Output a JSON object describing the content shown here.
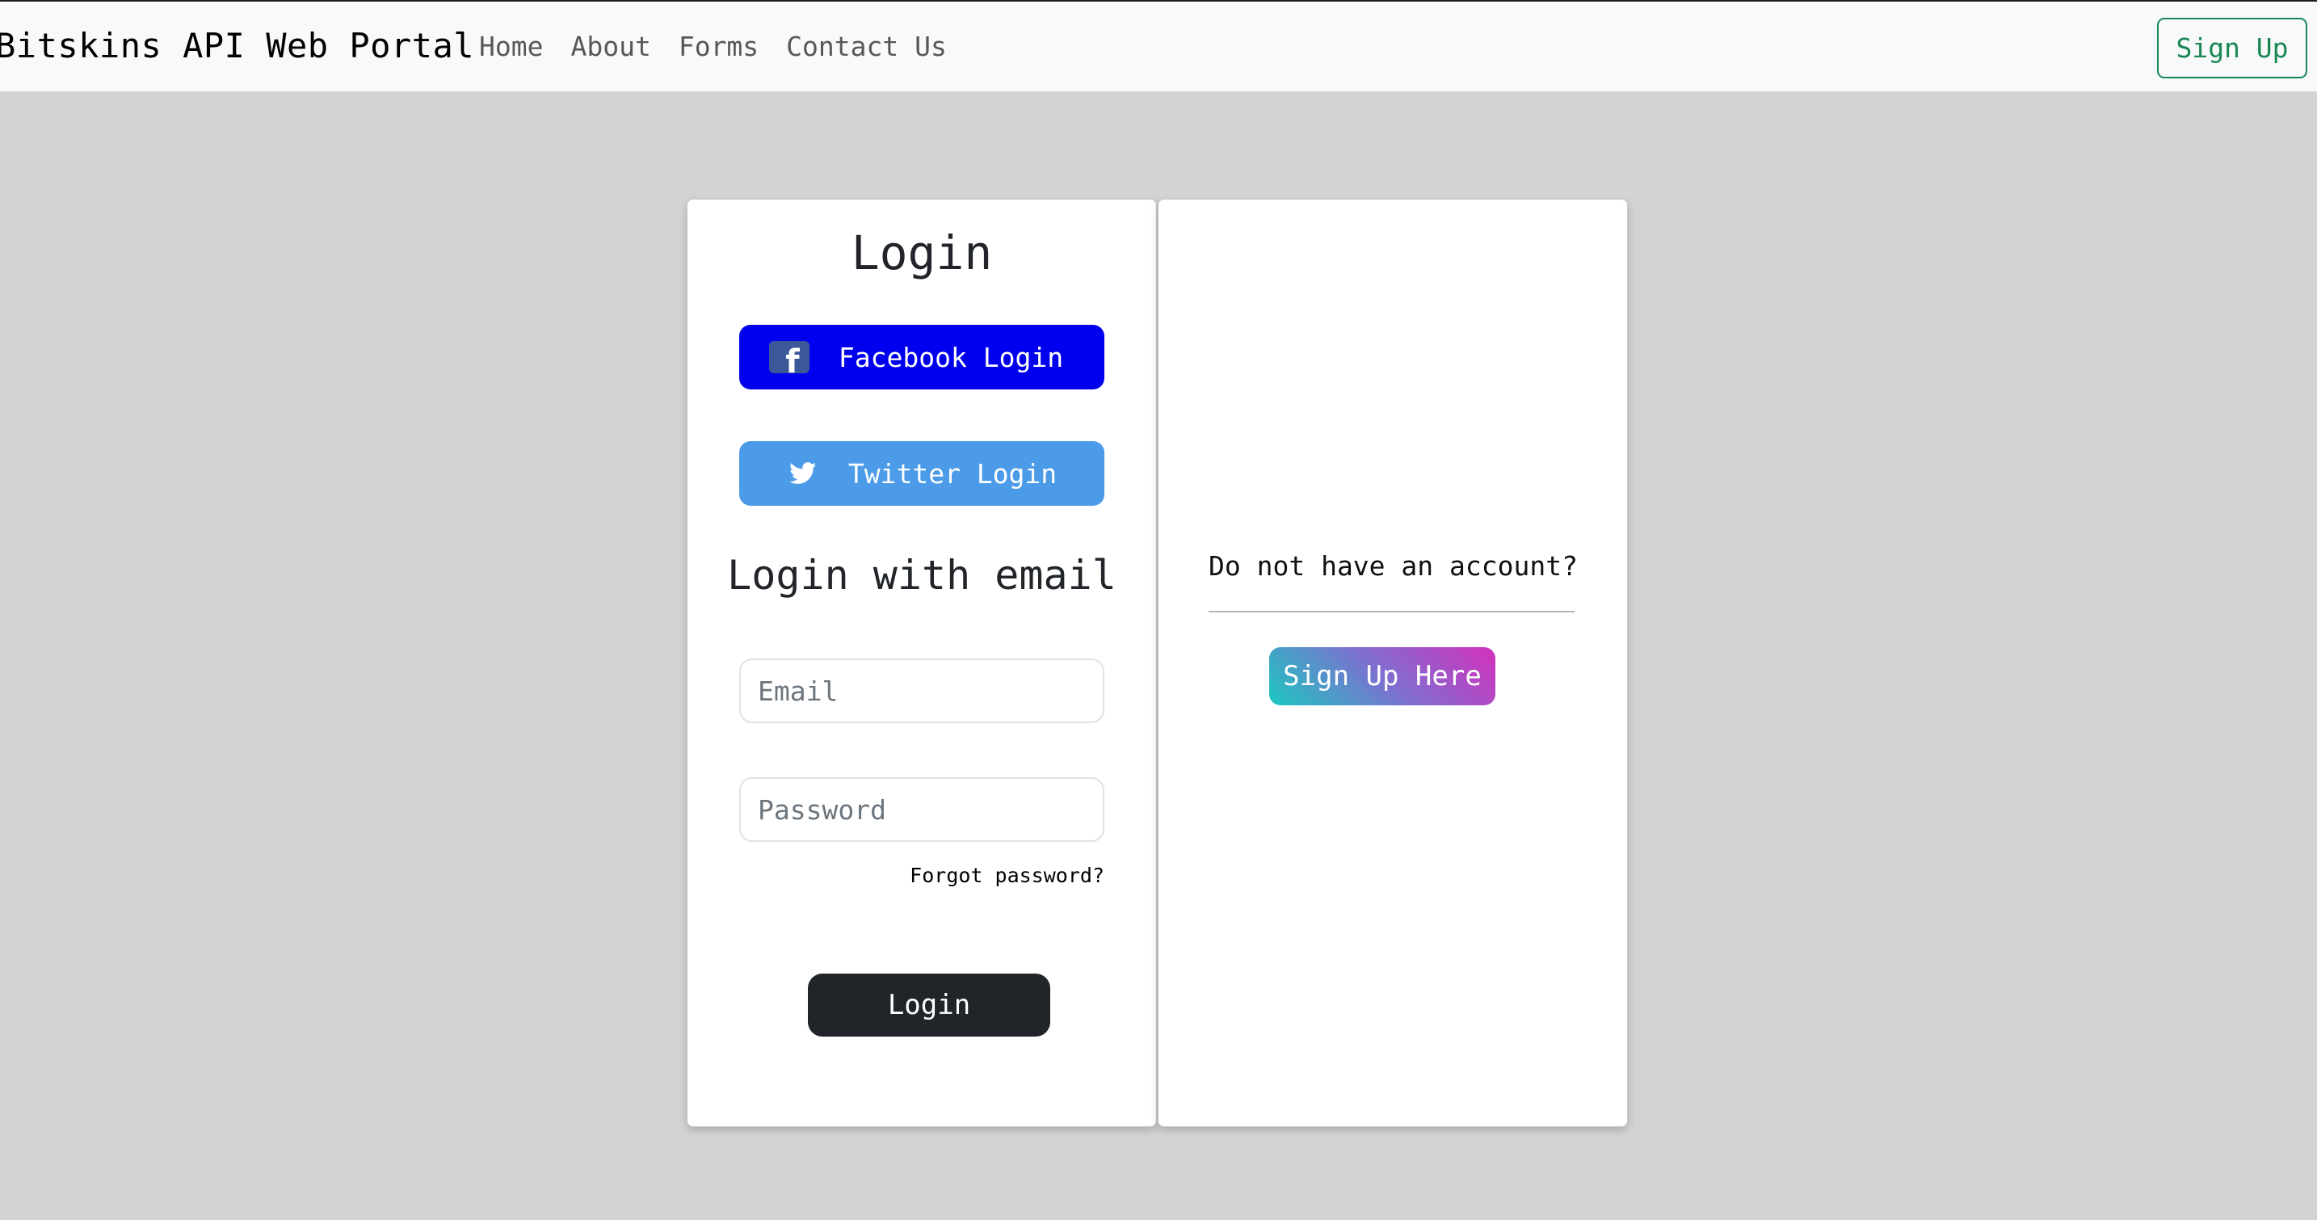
{
  "navbar": {
    "brand": "Bitskins API Web Portal",
    "links": [
      "Home",
      "About",
      "Forms",
      "Contact Us"
    ],
    "signup_label": "Sign Up"
  },
  "login_card": {
    "title": "Login",
    "facebook_label": "Facebook Login",
    "facebook_icon": "facebook-icon",
    "twitter_label": "Twitter Login",
    "twitter_icon": "twitter-icon",
    "email_section_title": "Login with email",
    "email_placeholder": "Email",
    "password_placeholder": "Password",
    "forgot_label": "Forgot password?",
    "login_label": "Login"
  },
  "signup_card": {
    "prompt": "Do not have an account?",
    "button_label": "Sign Up Here"
  },
  "colors": {
    "page_bg": "#d3d3d3",
    "facebook": "#0000ee",
    "twitter": "#4c9be8",
    "login_button": "#212529",
    "signup_outline": "#198754"
  }
}
